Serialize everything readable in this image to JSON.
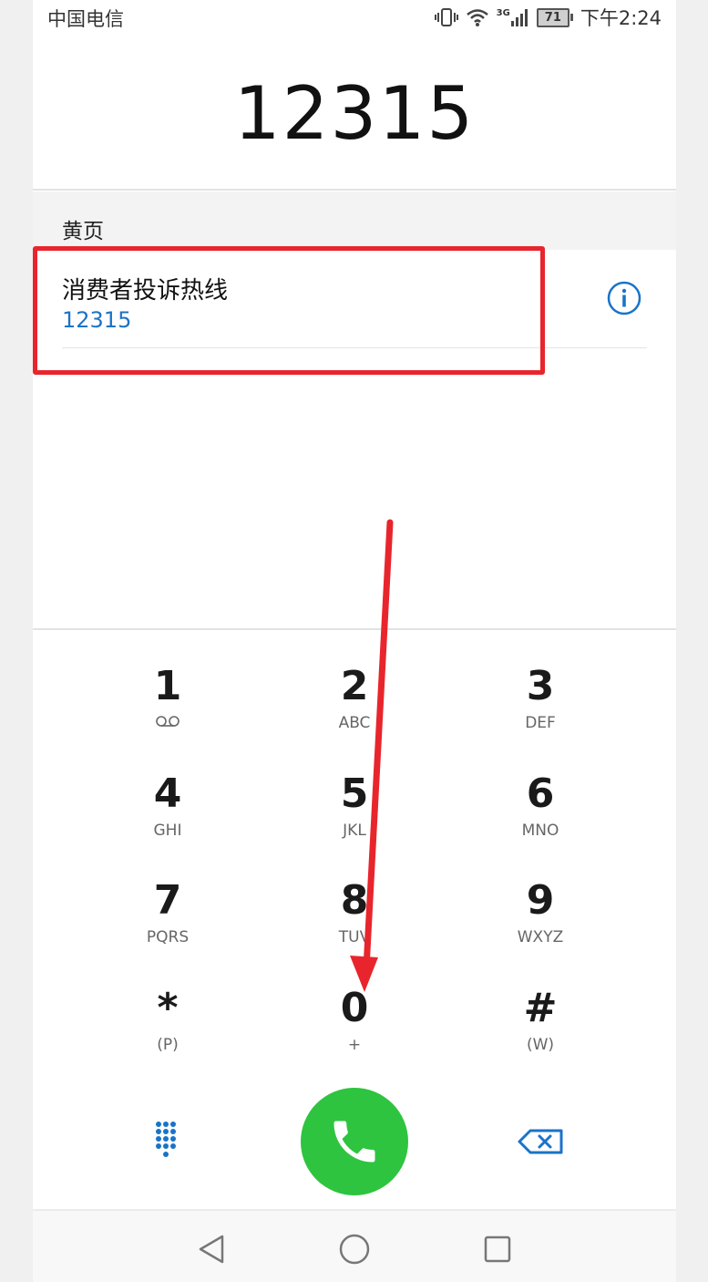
{
  "status_bar": {
    "carrier": "中国电信",
    "network": "3G",
    "battery": "71",
    "time": "下午2:24"
  },
  "dialer": {
    "dialed_number": "12315"
  },
  "search_results": {
    "section_title": "黄页",
    "items": [
      {
        "name": "消费者投诉热线",
        "number": "12315"
      }
    ]
  },
  "keypad": {
    "keys": [
      {
        "digit": "1",
        "letters": ""
      },
      {
        "digit": "2",
        "letters": "ABC"
      },
      {
        "digit": "3",
        "letters": "DEF"
      },
      {
        "digit": "4",
        "letters": "GHI"
      },
      {
        "digit": "5",
        "letters": "JKL"
      },
      {
        "digit": "6",
        "letters": "MNO"
      },
      {
        "digit": "7",
        "letters": "PQRS"
      },
      {
        "digit": "8",
        "letters": "TUV"
      },
      {
        "digit": "9",
        "letters": "WXYZ"
      },
      {
        "digit": "*",
        "letters": "(P)"
      },
      {
        "digit": "0",
        "letters": "+"
      },
      {
        "digit": "#",
        "letters": "(W)"
      }
    ]
  },
  "colors": {
    "accent_blue": "#1a73c8",
    "call_green": "#2ec43f",
    "annotation_red": "#e8252c"
  }
}
